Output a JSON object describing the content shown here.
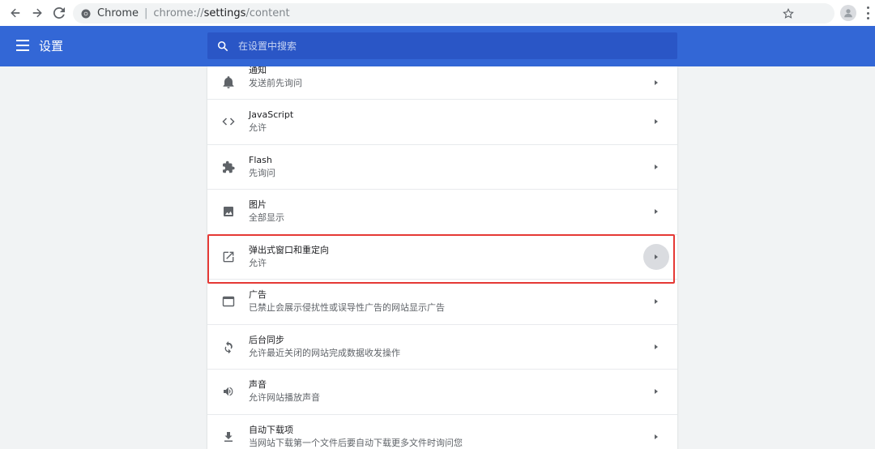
{
  "browser": {
    "chip_label": "Chrome",
    "url_scheme": "chrome://",
    "url_host": "settings",
    "url_path": "/content"
  },
  "header": {
    "title": "设置",
    "search_placeholder": "在设置中搜索"
  },
  "settings_rows": [
    {
      "icon": "bell-icon",
      "title": "通知",
      "subtitle": "发送前先询问"
    },
    {
      "icon": "code-icon",
      "title": "JavaScript",
      "subtitle": "允许"
    },
    {
      "icon": "puzzle-icon",
      "title": "Flash",
      "subtitle": "先询问"
    },
    {
      "icon": "image-icon",
      "title": "图片",
      "subtitle": "全部显示"
    },
    {
      "icon": "open-in-new-icon",
      "title": "弹出式窗口和重定向",
      "subtitle": "允许",
      "highlighted": true
    },
    {
      "icon": "web-asset-icon",
      "title": "广告",
      "subtitle": "已禁止会展示侵扰性或误导性广告的网站显示广告"
    },
    {
      "icon": "sync-icon",
      "title": "后台同步",
      "subtitle": "允许最近关闭的网站完成数据收发操作"
    },
    {
      "icon": "volume-icon",
      "title": "声音",
      "subtitle": "允许网站播放声音"
    },
    {
      "icon": "download-icon",
      "title": "自动下载项",
      "subtitle": "当网站下载第一个文件后要自动下载更多文件时询问您"
    }
  ],
  "colors": {
    "header_bg": "#3367d6",
    "search_bg": "#2a56c6",
    "highlight_border": "#e53935"
  }
}
